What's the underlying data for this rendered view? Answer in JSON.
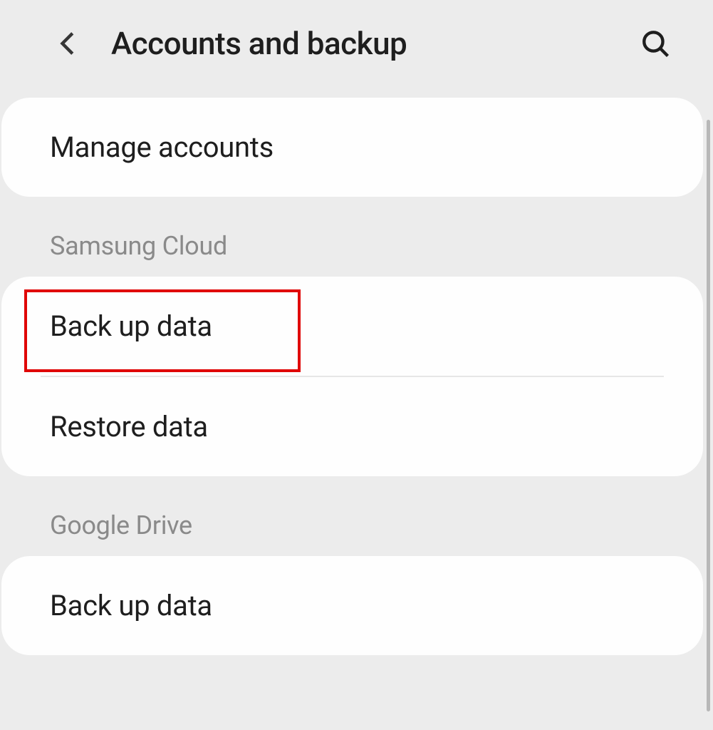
{
  "header": {
    "title": "Accounts and backup"
  },
  "sections": {
    "accounts": {
      "manage": "Manage accounts"
    },
    "samsungCloud": {
      "header": "Samsung Cloud",
      "backup": "Back up data",
      "restore": "Restore data"
    },
    "googleDrive": {
      "header": "Google Drive",
      "backup": "Back up data"
    }
  }
}
